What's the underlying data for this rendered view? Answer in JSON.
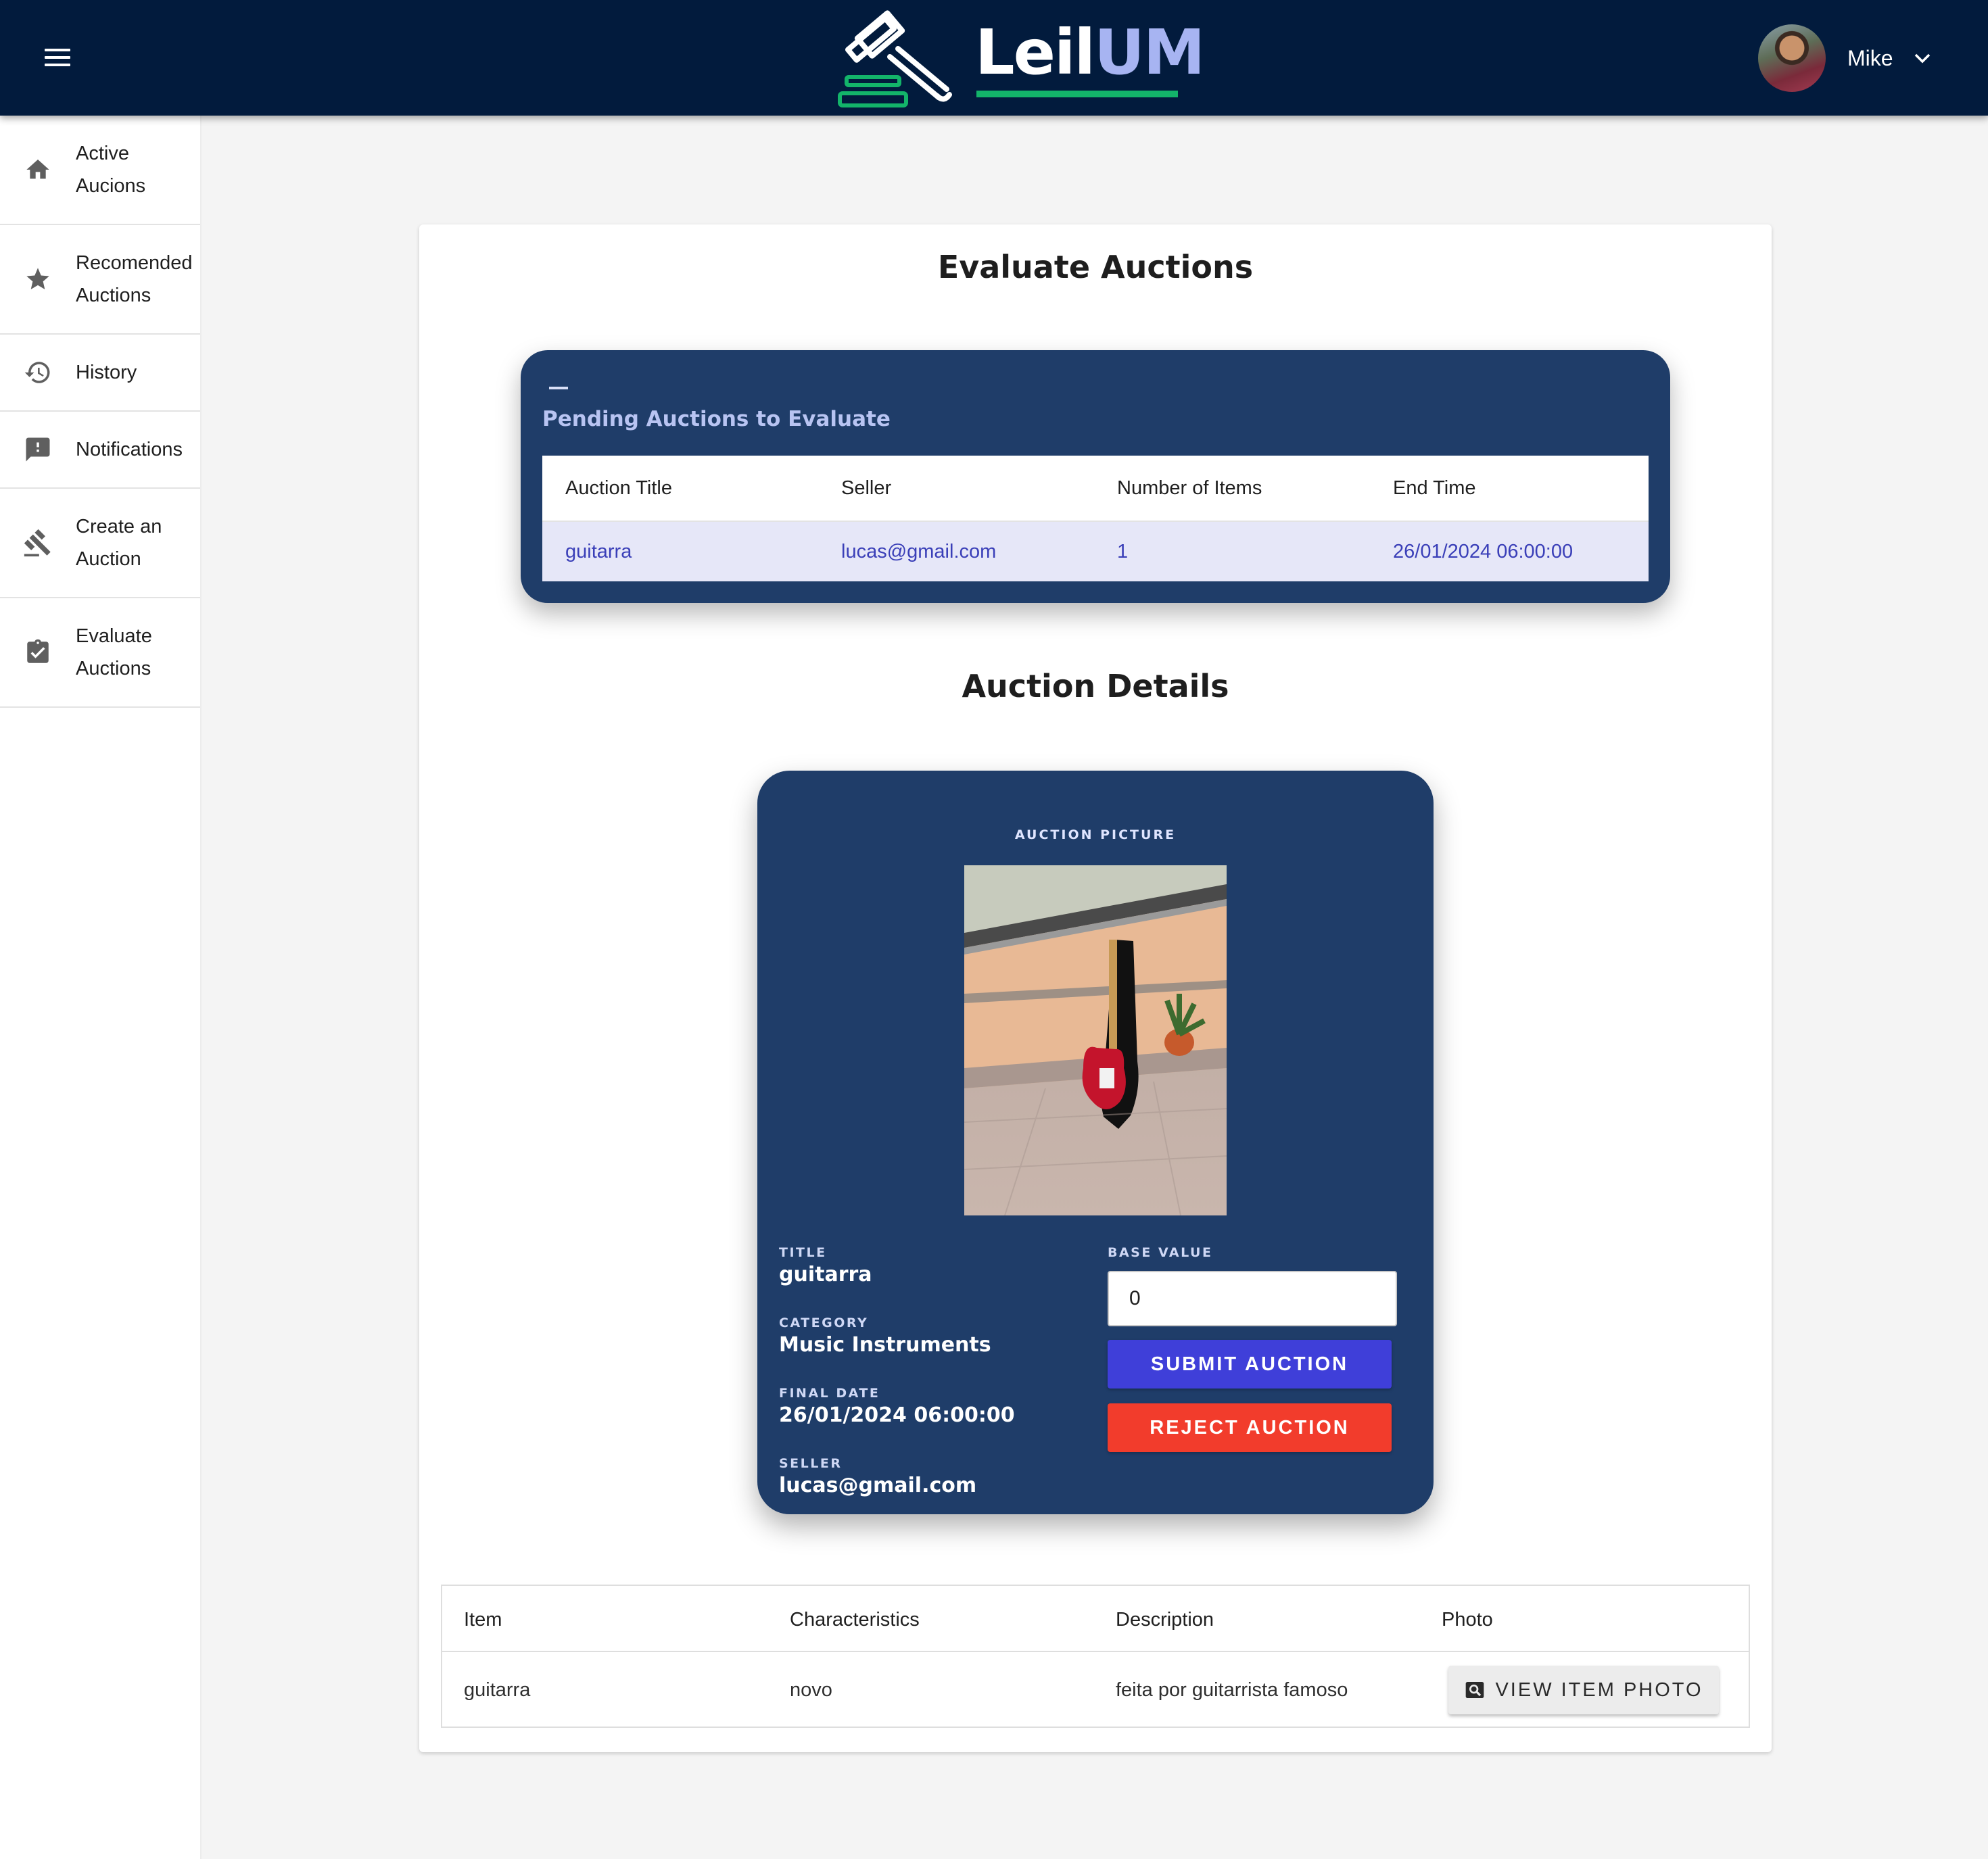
{
  "header": {
    "brand_part1": "Leil",
    "brand_part2": "UM",
    "user_name": "Mike",
    "colors": {
      "bar": "#021b3d",
      "brand_accent": "#a7b4f2",
      "brand_green": "#13b46a"
    }
  },
  "sidebar": {
    "items": [
      {
        "label_line1": "Active",
        "label_line2": "Aucions",
        "icon": "home-icon"
      },
      {
        "label_line1": "Recomended",
        "label_line2": "Auctions",
        "icon": "star-icon"
      },
      {
        "label_line1": "History",
        "label_line2": "",
        "icon": "history-icon"
      },
      {
        "label_line1": "Notifications",
        "label_line2": "",
        "icon": "notification-icon"
      },
      {
        "label_line1": "Create an",
        "label_line2": "Auction",
        "icon": "gavel-icon"
      },
      {
        "label_line1": "Evaluate",
        "label_line2": "Auctions",
        "icon": "clipboard-check-icon"
      }
    ]
  },
  "main": {
    "title": "Evaluate Auctions",
    "pending": {
      "title": "Pending Auctions to Evaluate",
      "columns": [
        "Auction Title",
        "Seller",
        "Number of Items",
        "End Time"
      ],
      "rows": [
        {
          "title": "guitarra",
          "seller": "lucas@gmail.com",
          "items": "1",
          "end_time": "26/01/2024 06:00:00"
        }
      ]
    },
    "details_title": "Auction Details",
    "details": {
      "picture_label": "AUCTION PICTURE",
      "title_label": "TITLE",
      "title_value": "guitarra",
      "category_label": "CATEGORY",
      "category_value": "Music Instruments",
      "final_date_label": "FINAL DATE",
      "final_date_value": "26/01/2024 06:00:00",
      "seller_label": "SELLER",
      "seller_value": "lucas@gmail.com",
      "base_value_label": "BASE VALUE",
      "base_value": "0",
      "submit_label": "SUBMIT AUCTION",
      "reject_label": "REJECT AUCTION"
    },
    "items_table": {
      "columns": [
        "Item",
        "Characteristics",
        "Description",
        "Photo"
      ],
      "rows": [
        {
          "item": "guitarra",
          "characteristics": "novo",
          "description": "feita por guitarrista famoso",
          "photo_button": "VIEW ITEM PHOTO"
        }
      ]
    }
  }
}
